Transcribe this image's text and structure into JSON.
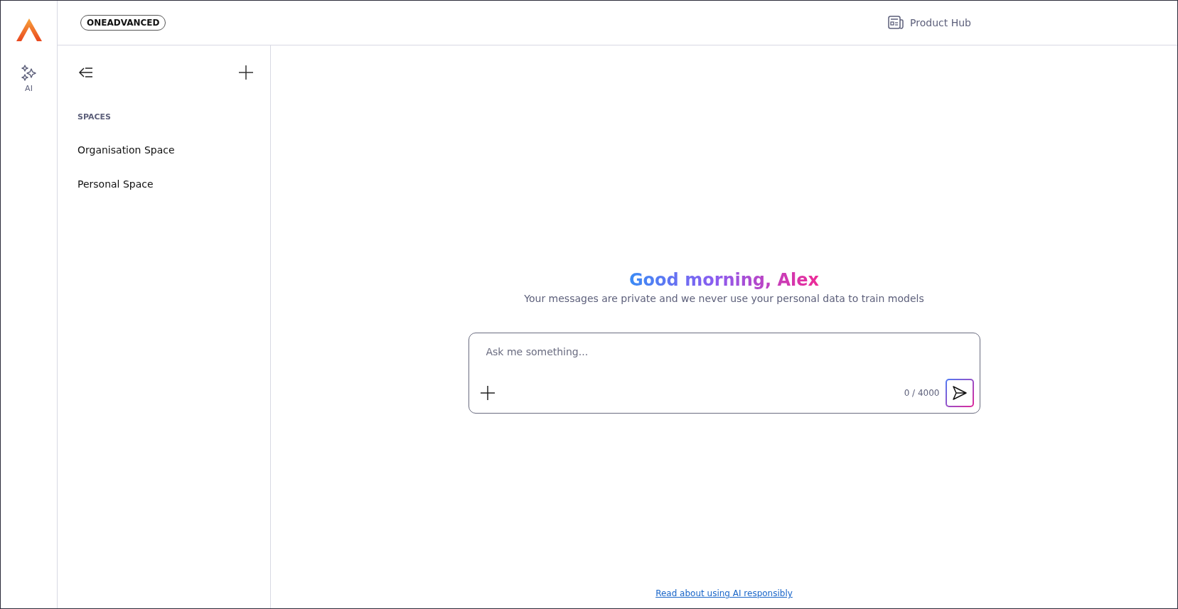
{
  "rail": {
    "items": [
      {
        "label": "AI",
        "selected": false
      }
    ]
  },
  "header": {
    "brand": "ONEADVANCED",
    "product_hub": "Product Hub"
  },
  "sidebar": {
    "section": "SPACES",
    "items": [
      {
        "label": "Organisation Space"
      },
      {
        "label": "Personal Space"
      }
    ]
  },
  "main": {
    "greeting": "Good morning, Alex",
    "subtitle": "Your messages are private and we never use your personal data to train models",
    "input": {
      "placeholder": "Ask me something...",
      "counter": "0 / 4000"
    },
    "footer_link": "Read about using AI responsibly"
  }
}
